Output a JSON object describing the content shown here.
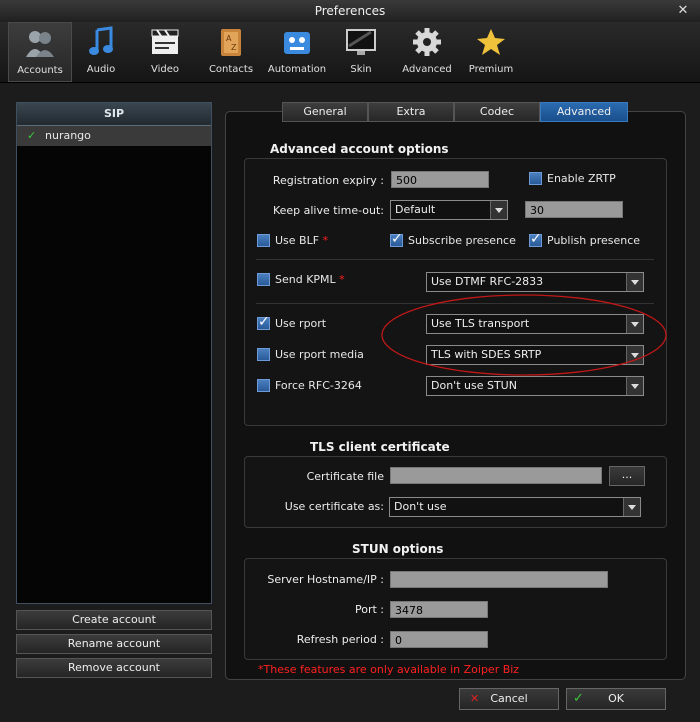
{
  "window": {
    "title": "Preferences"
  },
  "toolbar": {
    "items": [
      {
        "label": "Accounts",
        "icon": "accounts-icon",
        "active": true
      },
      {
        "label": "Audio",
        "icon": "audio-icon"
      },
      {
        "label": "Video",
        "icon": "video-icon"
      },
      {
        "label": "Contacts",
        "icon": "contacts-icon"
      },
      {
        "label": "Automation",
        "icon": "automation-icon"
      },
      {
        "label": "Skin",
        "icon": "skin-icon"
      },
      {
        "label": "Advanced",
        "icon": "advanced-icon"
      },
      {
        "label": "Premium",
        "icon": "premium-icon"
      }
    ]
  },
  "sidebar": {
    "header": "SIP",
    "accounts": [
      {
        "name": "nurango",
        "check": "✓"
      }
    ],
    "buttons": {
      "create": "Create account",
      "rename": "Rename account",
      "remove": "Remove account"
    }
  },
  "tabs": [
    {
      "label": "General"
    },
    {
      "label": "Extra"
    },
    {
      "label": "Codec"
    },
    {
      "label": "Advanced",
      "active": true
    }
  ],
  "advanced": {
    "title": "Advanced account options",
    "registration_expiry": {
      "label": "Registration expiry :",
      "value": "500"
    },
    "enable_zrtp": {
      "label": "Enable ZRTP",
      "checked": false
    },
    "keep_alive": {
      "label": "Keep alive time-out:",
      "select": "Default",
      "value": "30"
    },
    "use_blf": {
      "label": "Use BLF",
      "star": "*",
      "checked": false
    },
    "subscribe_presence": {
      "label": "Subscribe presence",
      "checked": true
    },
    "publish_presence": {
      "label": "Publish presence",
      "checked": true
    },
    "send_kpml": {
      "label": "Send KPML",
      "star": "*",
      "checked": false
    },
    "dtmf_select": "Use DTMF RFC-2833",
    "use_rport": {
      "label": "Use rport",
      "checked": true
    },
    "transport_select": "Use TLS transport",
    "use_rport_media": {
      "label": "Use rport media",
      "checked": false
    },
    "srtp_select": "TLS with SDES SRTP",
    "force_rfc3264": {
      "label": "Force RFC-3264",
      "checked": false
    },
    "stun_select": "Don't use STUN"
  },
  "tls": {
    "title": "TLS client certificate",
    "certificate_file": {
      "label": "Certificate file",
      "value": ""
    },
    "browse_label": "...",
    "use_certificate_as": {
      "label": "Use certificate as:",
      "select": "Don't use"
    }
  },
  "stun": {
    "title": "STUN options",
    "server": {
      "label": "Server Hostname/IP :",
      "value": ""
    },
    "port": {
      "label": "Port :",
      "value": "3478"
    },
    "refresh": {
      "label": "Refresh period :",
      "value": "0"
    }
  },
  "footer": {
    "note": "*These features are only available in Zoiper Biz",
    "cancel": "Cancel",
    "ok": "OK"
  },
  "colors": {
    "accent": "#1a4f8c",
    "warning": "#ff2020",
    "ok_check": "#3cc83c",
    "cancel_x": "#e02020",
    "annotation": "#c01818"
  }
}
